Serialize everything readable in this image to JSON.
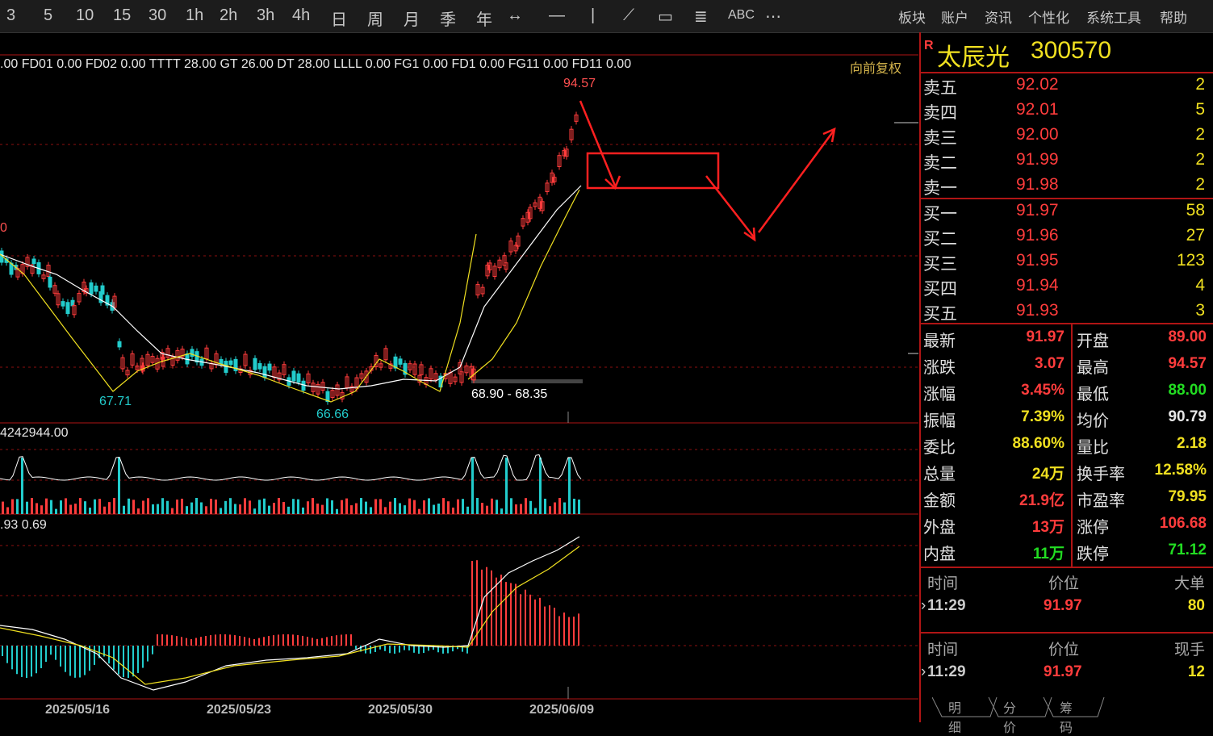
{
  "toolbar": {
    "periods": [
      "3",
      "5",
      "10",
      "15",
      "30",
      "1h",
      "2h",
      "3h",
      "4h",
      "日",
      "周",
      "月",
      "季",
      "年"
    ],
    "tools_text": "ABC",
    "menus": [
      "板块",
      "账户",
      "资讯",
      "个性化",
      "系统工具",
      "帮助"
    ]
  },
  "indicators": {
    "main_line": ".00  FD01 0.00   FD02 0.00   TTTT 28.00   GT 26.00   DT 28.00   LLLL 0.00   FG1 0.00   FD1 0.00   FG11 0.00   FD11 0.00",
    "restore_label": "向前复权",
    "volume_line": "4242944.00",
    "macd_line": ".93     0.69"
  },
  "annotations": {
    "high_label": "94.57",
    "left_label": "0",
    "low1_label": "67.71",
    "low2_label": "66.66",
    "range_label": "68.90 - 68.35"
  },
  "dates": [
    "2025/05/16",
    "2025/05/23",
    "2025/05/30",
    "2025/06/09"
  ],
  "stock": {
    "badge": "R",
    "name": "太辰光",
    "code": "300570"
  },
  "order_book": {
    "asks": [
      {
        "label": "卖五",
        "price": "92.02",
        "vol": "2"
      },
      {
        "label": "卖四",
        "price": "92.01",
        "vol": "5"
      },
      {
        "label": "卖三",
        "price": "92.00",
        "vol": "2"
      },
      {
        "label": "卖二",
        "price": "91.99",
        "vol": "2"
      },
      {
        "label": "卖一",
        "price": "91.98",
        "vol": "2"
      }
    ],
    "bids": [
      {
        "label": "买一",
        "price": "91.97",
        "vol": "58"
      },
      {
        "label": "买二",
        "price": "91.96",
        "vol": "27"
      },
      {
        "label": "买三",
        "price": "91.95",
        "vol": "123"
      },
      {
        "label": "买四",
        "price": "91.94",
        "vol": "4"
      },
      {
        "label": "买五",
        "price": "91.93",
        "vol": "3"
      }
    ]
  },
  "stats": {
    "left": [
      {
        "label": "最新",
        "value": "91.97",
        "color": "red"
      },
      {
        "label": "涨跌",
        "value": "3.07",
        "color": "red"
      },
      {
        "label": "涨幅",
        "value": "3.45%",
        "color": "red"
      },
      {
        "label": "振幅",
        "value": "7.39%",
        "color": "yellow"
      },
      {
        "label": "委比",
        "value": "88.60%",
        "color": "yellow"
      },
      {
        "label": "总量",
        "value": "24万",
        "color": "yellow"
      },
      {
        "label": "金额",
        "value": "21.9亿",
        "color": "red"
      },
      {
        "label": "外盘",
        "value": "13万",
        "color": "red"
      },
      {
        "label": "内盘",
        "value": "11万",
        "color": "green"
      }
    ],
    "right": [
      {
        "label": "开盘",
        "value": "89.00",
        "color": "red"
      },
      {
        "label": "最高",
        "value": "94.57",
        "color": "red"
      },
      {
        "label": "最低",
        "value": "88.00",
        "color": "green"
      },
      {
        "label": "均价",
        "value": "90.79",
        "color": "white"
      },
      {
        "label": "量比",
        "value": "2.18",
        "color": "yellow"
      },
      {
        "label": "换手率",
        "value": "12.58%",
        "color": "yellow"
      },
      {
        "label": "市盈率",
        "value": "79.95",
        "color": "yellow"
      },
      {
        "label": "涨停",
        "value": "106.68",
        "color": "red"
      },
      {
        "label": "跌停",
        "value": "71.12",
        "color": "green"
      }
    ]
  },
  "trades1": {
    "headers": [
      "时间",
      "价位",
      "大单"
    ],
    "row": {
      "time": "11:29",
      "price": "91.97",
      "vol": "80"
    }
  },
  "trades2": {
    "headers": [
      "时间",
      "价位",
      "现手"
    ],
    "row": {
      "time": "11:29",
      "price": "91.97",
      "vol": "12"
    }
  },
  "tabs": [
    "明细",
    "分价",
    "筹码"
  ],
  "colors": {
    "up": "#ff3c3c",
    "down": "#22cccc",
    "accent": "#b01515",
    "ma": "#f0e020"
  }
}
